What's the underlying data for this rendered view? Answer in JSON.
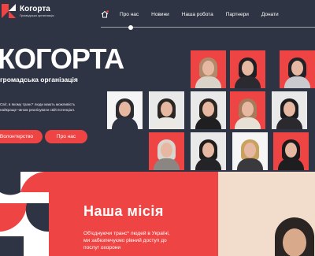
{
  "header": {
    "logo_name": "Когорта",
    "logo_sub": "Громадська організація",
    "nav": [
      "Про нас",
      "Новини",
      "Наша робота",
      "Партнери",
      "Донати"
    ]
  },
  "hero": {
    "title": "КОГОРТА",
    "subtitle": "громадська організація",
    "description": "Світ, в якому транс* люди мають можливість найкраще чином реалізувати свій потенціал.",
    "btn_volunteer": "Волонтерство",
    "btn_about": "Про нас"
  },
  "mission": {
    "title": "Наша місія",
    "text": "Об'єднуючи транс* людей в Україні, ми забезпечуємо рівний доступ до послуг охорони"
  },
  "colors": {
    "brand_red": "#ef4444",
    "navy": "#2f3444"
  }
}
